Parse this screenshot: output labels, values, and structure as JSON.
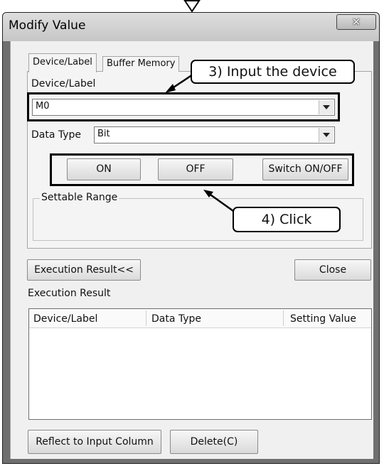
{
  "window": {
    "title": "Modify Value"
  },
  "tabs": [
    {
      "label": "Device/Label"
    },
    {
      "label": "Buffer Memory"
    }
  ],
  "device": {
    "label": "Device/Label",
    "value": "M0"
  },
  "data_type": {
    "label": "Data Type",
    "value": "Bit"
  },
  "buttons": {
    "on": "ON",
    "off": "OFF",
    "switch": "Switch ON/OFF"
  },
  "settable_range": {
    "label": "Settable Range"
  },
  "execution": {
    "toggle_label": "Execution Result<<",
    "close_label": "Close",
    "result_label": "Execution Result",
    "columns": [
      "Device/Label",
      "Data Type",
      "Setting Value"
    ]
  },
  "bottom": {
    "reflect_label": "Reflect to Input Column",
    "delete_label": "Delete(C)"
  },
  "annotations": {
    "step3": "3) Input the device",
    "step4": "4) Click"
  }
}
